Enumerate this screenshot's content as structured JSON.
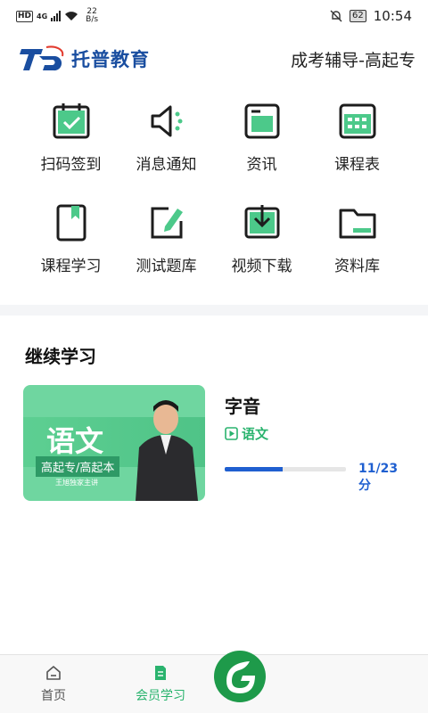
{
  "status_bar": {
    "hd": "HD",
    "network": "4G",
    "speed_value": "22",
    "speed_unit": "B/s",
    "battery": "62",
    "time": "10:54"
  },
  "header": {
    "logo_text": "托普教育",
    "subtitle": "成考辅导-高起专"
  },
  "grid": [
    {
      "label": "扫码签到",
      "icon": "calendar-check-icon"
    },
    {
      "label": "消息通知",
      "icon": "speaker-icon"
    },
    {
      "label": "资讯",
      "icon": "folder-window-icon"
    },
    {
      "label": "课程表",
      "icon": "calendar-grid-icon"
    },
    {
      "label": "课程学习",
      "icon": "bookmark-book-icon"
    },
    {
      "label": "测试题库",
      "icon": "edit-icon"
    },
    {
      "label": "视频下载",
      "icon": "download-icon"
    },
    {
      "label": "资料库",
      "icon": "folder-icon"
    }
  ],
  "continue_section": {
    "title": "继续学习"
  },
  "course": {
    "thumb_title": "语文",
    "thumb_tag": "高起专/高起本",
    "thumb_sub": "王旭独家主讲",
    "title": "字音",
    "category": "语文",
    "progress_text": "11/23分",
    "progress_fraction": 0.478
  },
  "bottom_nav": {
    "home": "首页",
    "member": "会员学习"
  },
  "colors": {
    "accent": "#2ab36e",
    "brand": "#1a4ea0",
    "progress": "#1f5fd0"
  }
}
